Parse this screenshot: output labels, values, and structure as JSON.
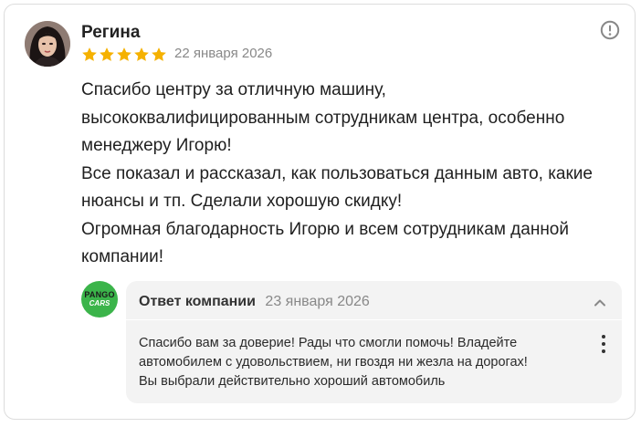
{
  "review": {
    "author": "Регина",
    "rating": 5,
    "date": "22 января 2026",
    "text_lines": [
      "Спасибо центру за отличную машину,",
      "высококвалифицированным сотрудникам центра, особенно",
      "менеджеру Игорю!",
      "Все показал и рассказал, как пользоваться данным авто, какие",
      "нюансы и тп. Сделали хорошую скидку!",
      "Огромная благодарность Игорю и всем сотрудникам данной",
      "компании!"
    ],
    "info_icon": "info-circle-icon",
    "star_color": "#f5b100"
  },
  "company_reply": {
    "logo_line1": "PANGO",
    "logo_line2": "CARS",
    "logo_color": "#3bb44a",
    "label": "Ответ компании",
    "date": "23 января 2026",
    "collapse_icon": "chevron-up-icon",
    "menu_icon": "more-vertical-icon",
    "text_lines": [
      "Спасибо вам за доверие! Рады что смогли помочь! Владейте",
      "автомобилем с удовольствием, ни гвоздя ни жезла на дорогах!",
      "Вы выбрали действительно хороший автомобиль"
    ]
  }
}
